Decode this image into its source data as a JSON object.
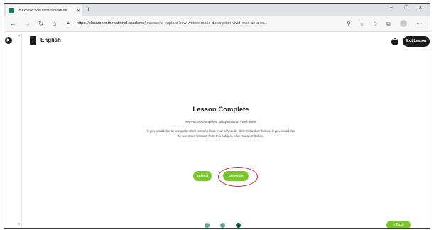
{
  "browser": {
    "tab_title": "To explore how writers make de...",
    "tab_close": "✕",
    "new_tab": "+",
    "window_controls": {
      "minimize": "–",
      "restore": "❐",
      "close": "✕"
    },
    "url_host": "https://classroom.thenational.academy",
    "url_path": "/lessons/to-explore-how-writers-make-description-vivid-read-as-a-wr...",
    "icons": [
      "back-icon",
      "forward-icon",
      "refresh-icon",
      "home-icon",
      "lock-icon",
      "zoom-icon",
      "favorite-icon",
      "favorites-icon",
      "collections-icon",
      "profile-icon",
      "menu-icon"
    ]
  },
  "page": {
    "subject_title": "English",
    "exit_label": "Exit Lesson",
    "more_label": "•••",
    "lesson": {
      "heading": "Lesson Complete",
      "message1": "You've now completed today's lesson - well done!",
      "message2": "If you would like to complete other lessons from your schedule, click 'Schedule' below. If you would like to see more lessons from this subject, click 'Subject' below."
    },
    "buttons": {
      "subject": "Subject",
      "schedule": "Schedule"
    },
    "back_label": "< Back",
    "progress_dots": {
      "count": 3,
      "active_index": 2
    },
    "colors": {
      "accent": "#7bc62d",
      "dark": "#1b1b1b",
      "highlight": "#d42828",
      "dot": "#66a397",
      "dot_active": "#0c5a3e"
    }
  }
}
